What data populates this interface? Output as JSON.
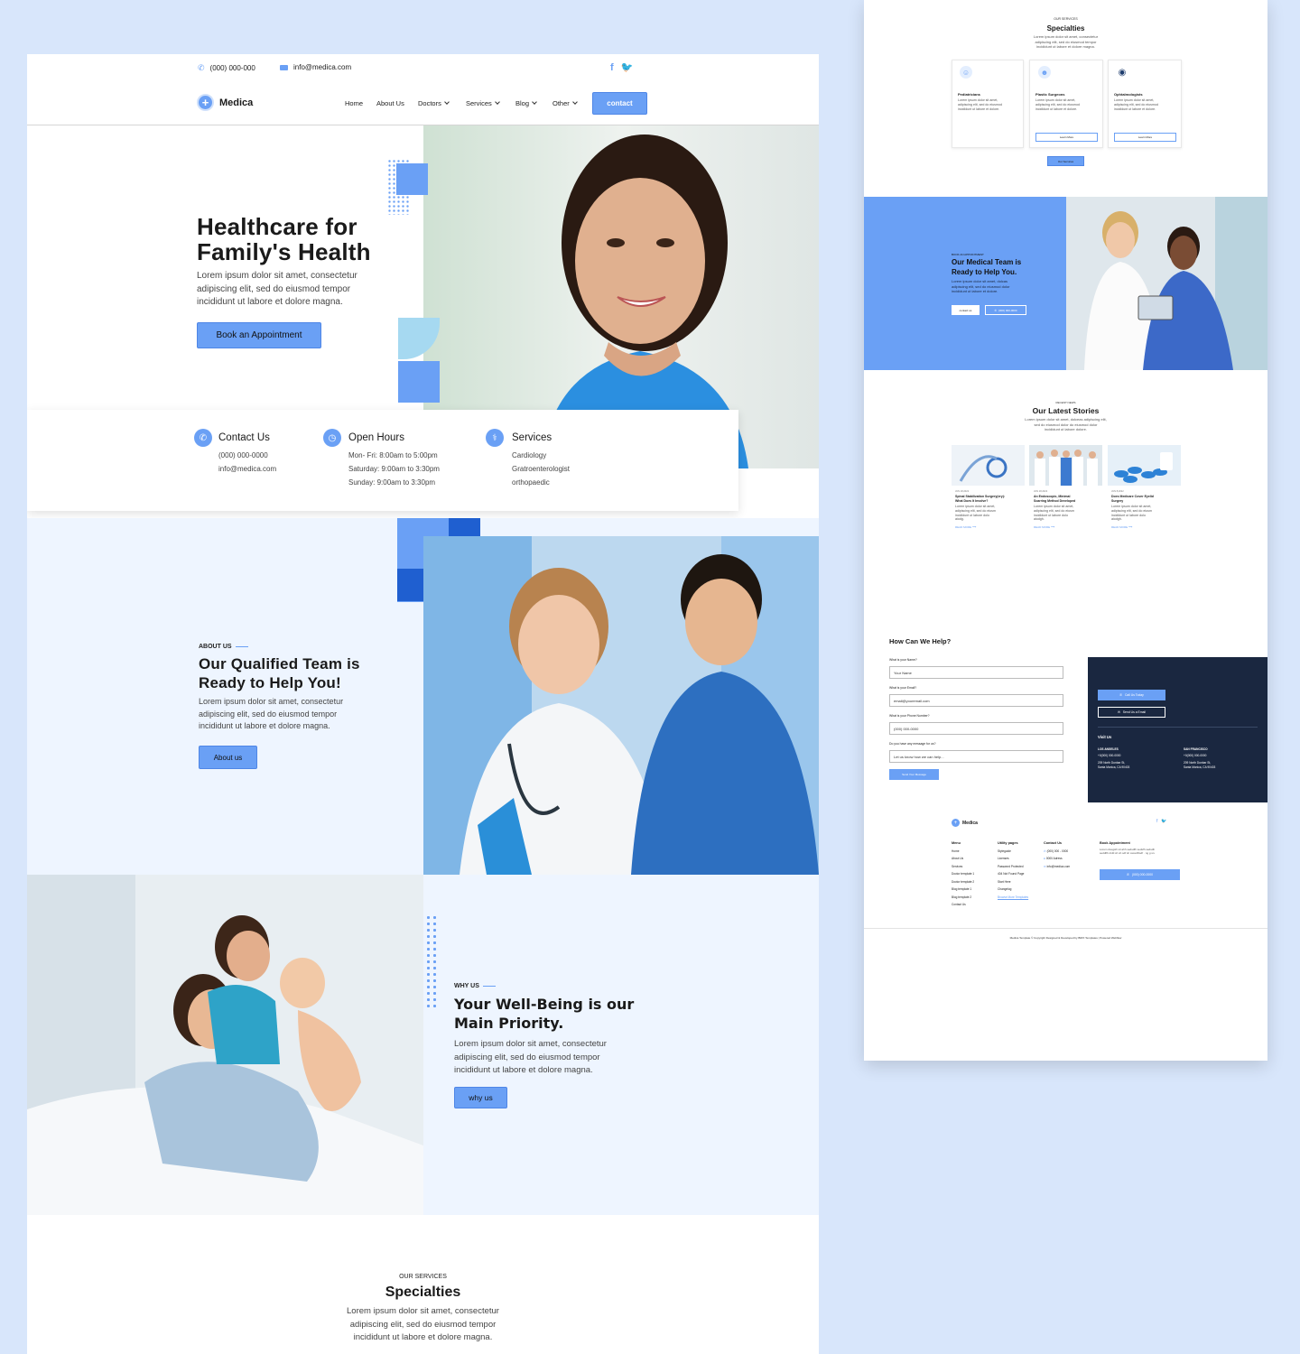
{
  "colors": {
    "accent": "#6aa0f5",
    "accent_dark": "#1f5fd0",
    "light_bg": "#eef5ff",
    "outer_bg": "#d8e6fb",
    "navy": "#1a2740"
  },
  "topbar": {
    "phone": "(000) 000-000",
    "email": "info@medica.com"
  },
  "brand": {
    "name": "Medica"
  },
  "nav": {
    "home": "Home",
    "about": "About Us",
    "doctors": "Doctors",
    "services": "Services",
    "blog": "Blog",
    "other": "Other",
    "contact": "contact"
  },
  "hero": {
    "title_line1": "Healthcare for",
    "title_line2": "Family's Health",
    "text_line1": "Lorem ipsum dolor sit amet, consectetur",
    "text_line2": "adipiscing elit, sed do eiusmod tempor",
    "text_line3": "incididunt ut labore et dolore magna.",
    "button": "Book an Appointment"
  },
  "info": {
    "contact": {
      "title": "Contact Us",
      "line1": "(000) 000-0000",
      "line2": "info@medica.com"
    },
    "hours": {
      "title": "Open Hours",
      "line1": "Mon- Fri: 8:00am to 5:00pm",
      "line2": "Saturday: 9:00am to 3:30pm",
      "line3": "Sunday: 9:00am to 3:30pm"
    },
    "services": {
      "title": "Services",
      "line1": "Cardiology",
      "line2": "Gratroenterologist",
      "line3": "orthopaedic"
    }
  },
  "about": {
    "eyebrow": "ABOUT US",
    "title_line1": "Our Qualified Team is",
    "title_line2": "Ready to Help You!",
    "text_line1": "Lorem ipsum dolor sit amet, consectetur",
    "text_line2": "adipiscing elit, sed do eiusmod tempor",
    "text_line3": "incididunt ut labore et dolore magna.",
    "button": "About us"
  },
  "why": {
    "eyebrow": "WHY US",
    "title_line1": "Your Well-Being is our",
    "title_line2": "Main Priority.",
    "text_line1": "Lorem ipsum dolor sit amet, consectetur",
    "text_line2": "adipiscing elit, sed do eiusmod tempor",
    "text_line3": "incididunt ut labore et dolore magna.",
    "button": "why us"
  },
  "specialties": {
    "eyebrow": "OUR SERVICES",
    "title": "Specialties",
    "text_line1": "Lorem ipsum dolor sit amet, consectetur",
    "text_line2": "adipiscing elit, sed do eiusmod tempor",
    "text_line3": "incididunt ut labore et dolore magna."
  },
  "mini": {
    "spec": {
      "eyebrow": "OUR SERVICES",
      "title": "Specialties",
      "text_line1": "Lorem ipsum dolor sit amet, consectetur",
      "text_line2": "adipiscing elit, sed do eiusmod tempor",
      "text_line3": "incididunt ut labore et dolore magna.",
      "cards": [
        {
          "title": "Pediatricians",
          "l1": "Lorem ipsum dolor sit amet,",
          "l2": "adipiscing elit, sed do eiusmod",
          "l3": "incididunt ut labore et dolore.",
          "btn": ""
        },
        {
          "title": "Plastic Surgeons",
          "l1": "Lorem ipsum dolor sit amet,",
          "l2": "adipiscing elit, sed do eiusmod",
          "l3": "incididunt ut labore et dolore.",
          "btn": "Learn More"
        },
        {
          "title": "Ophtalmologists",
          "l1": "Lorem ipsum dolor sit amet,",
          "l2": "adipiscing elit, sed do eiusmod",
          "l3": "incididunt ut labore et dolore.",
          "btn": "Learn More"
        }
      ],
      "button": "Our Services"
    },
    "appt": {
      "eyebrow": "BOOK AN APPOINTMENT",
      "title_line1": "Our Medical Team is",
      "title_line2": "Ready to Help You.",
      "text_line1": "Lorem ipsum dolor sit amet, dolcas",
      "text_line2": "adipiscing elit, sed do eiusmod dolor",
      "text_line3": "incididunt ut labore et dolore.",
      "btn_contact": "contact us",
      "btn_phone": "(000) 000-0000"
    },
    "news": {
      "eyebrow": "RECENT NEWS",
      "title": "Our Latest Stories",
      "text_line1": "Lorem ipsum dolor sit amet, dolceas adipiscing elit,",
      "text_line2": "sed do eiusmod dolor do eiusmod dolor",
      "text_line3": "incididunt ut labore dolore.",
      "items": [
        {
          "date": "JUN 18,2022",
          "t1": "Spinal Stabilization Surgery(ery):",
          "t2": "What Does It Involve?",
          "l1": "Lorem ipsum dolor sit amet,",
          "l2": "adipiscing elit, sed do eiusm",
          "l3": "incididunt ut labore dolo",
          "l4": "aiodg.",
          "more": "READ MORE"
        },
        {
          "date": "JUN 18,2022",
          "t1": "An Endoscopic, Minimal",
          "t2": "Scarring Method Developed",
          "l1": "Lorem ipsum dolor sit amet,",
          "l2": "adipiscing elit, sed do eiusm",
          "l3": "incididunt ut labore dolo",
          "l4": "aiodgh.",
          "more": "READ MORE"
        },
        {
          "date": "JUN 8,2022",
          "t1": "Does Medicare Cover Eyelid",
          "t2": "Surgery",
          "l1": "Lorem ipsum dolor sit amet,",
          "l2": "adipiscing elit, sed do eiusm",
          "l3": "incididunt ut labore dolo",
          "l4": "aiodgh.",
          "more": "READ MORE"
        }
      ]
    },
    "form": {
      "title": "How Can We Help?",
      "q_name": "What is your Name?",
      "v_name": "Your Name",
      "q_email": "What is your Email?",
      "v_email": "email@youremail.com",
      "q_phone": "What is your Phone Number?",
      "v_phone": "(000) 000-0000",
      "q_msg": "Do you have any message for us?",
      "v_msg": "Let us know how we can help...",
      "button": "Send Your Message"
    },
    "dark": {
      "call": "Call Us Today",
      "email": "Send Us a Email",
      "visit": "Visit Us",
      "la": "LOS ANGELES",
      "la_phone": "+0(000) 000-0000",
      "la_addr1": "209 North Dunbar St,",
      "la_addr2": "Santa Monica, CA 90403",
      "sf": "SAN FRANCISCO",
      "sf_phone": "+0(000) 000-0000",
      "sf_addr1": "209 North Dunbar St,",
      "sf_addr2": "Santa Monica, CA 90403"
    },
    "footer": {
      "brand": "Medica",
      "menu_title": "Menu",
      "menu": [
        "Home",
        "About Us",
        "Services",
        "Doctor template 1",
        "Doctor template 2",
        "Blog template 1",
        "Blog template 2",
        "Contact Us"
      ],
      "util_title": "Utility pages",
      "util": [
        "Styleguide",
        "Licenses",
        "Password Protected",
        "404 Not Found Page",
        "Start Here",
        "Changelog",
        "Browse More Templates"
      ],
      "contact_title": "Contact Us",
      "contact": [
        "(000) 000 - 0000",
        "0000 Adress",
        "info@medica.com"
      ],
      "book_title": "Book Appointment",
      "book_text1": "Lorem dougsih sit ahh sedsdfh sedsfh sedsdh",
      "book_text2": "seddfth dxfd sh sh sdf sh ssssdfzsdf · ng g sn.",
      "book_btn": "(000) 000-0000",
      "copyright": "Medica Template © Copyright Designed & Developed by BRIX Templates | Powered Webflow"
    }
  }
}
